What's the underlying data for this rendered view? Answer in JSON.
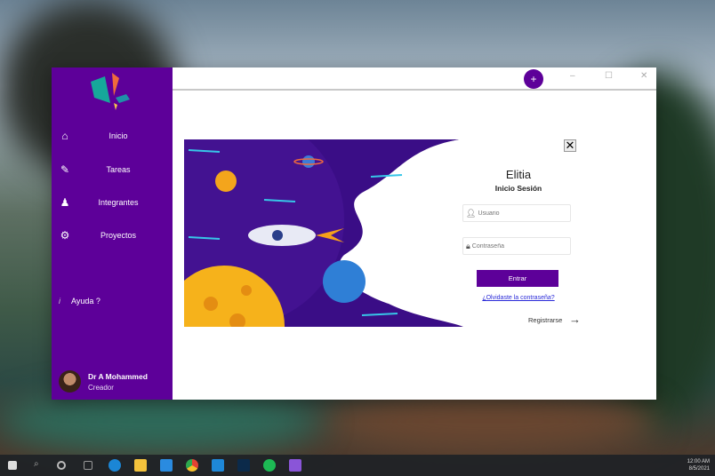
{
  "sidebar": {
    "items": [
      {
        "label": "Inicio",
        "icon": "home-icon"
      },
      {
        "label": "Tareas",
        "icon": "tasks-icon"
      },
      {
        "label": "Integrantes",
        "icon": "team-icon"
      },
      {
        "label": "Proyectos",
        "icon": "gear-icon"
      }
    ],
    "help": "Ayuda ?",
    "help_icon": "i",
    "user": {
      "name": "Dr A Mohammed",
      "role": "Creador"
    }
  },
  "titlebar": {
    "add": "+",
    "minimize": "–",
    "maximize": "☐",
    "close": "✕"
  },
  "login": {
    "close": "✕",
    "app_name": "Elitia",
    "subtitle": "Inicio Sesión",
    "user_placeholder": "Usuario",
    "password_placeholder": "Contraseña",
    "submit": "Entrar",
    "forgot": "¿Olvidaste la contraseña?",
    "register": "Registrarse",
    "register_arrow": "→"
  },
  "taskbar": {
    "time": "12:00 AM",
    "date": "8/5/2021"
  },
  "colors": {
    "accent": "#5d0099"
  }
}
